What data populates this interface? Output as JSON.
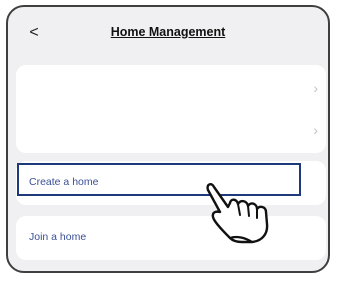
{
  "header": {
    "back_icon": "chevron-left-icon",
    "back_glyph": "<",
    "title": "Home Management"
  },
  "existing_homes": {
    "chevron_glyph": "›",
    "rows": 2
  },
  "actions": {
    "create_label": "Create a home",
    "join_label": "Join a home"
  },
  "overlay": {
    "highlight_target": "Create a home",
    "pointer_icon": "pointing-hand-icon"
  },
  "colors": {
    "background": "#f0f0f2",
    "card": "#ffffff",
    "label": "#3a4f96",
    "highlight": "#1f3a7a"
  }
}
